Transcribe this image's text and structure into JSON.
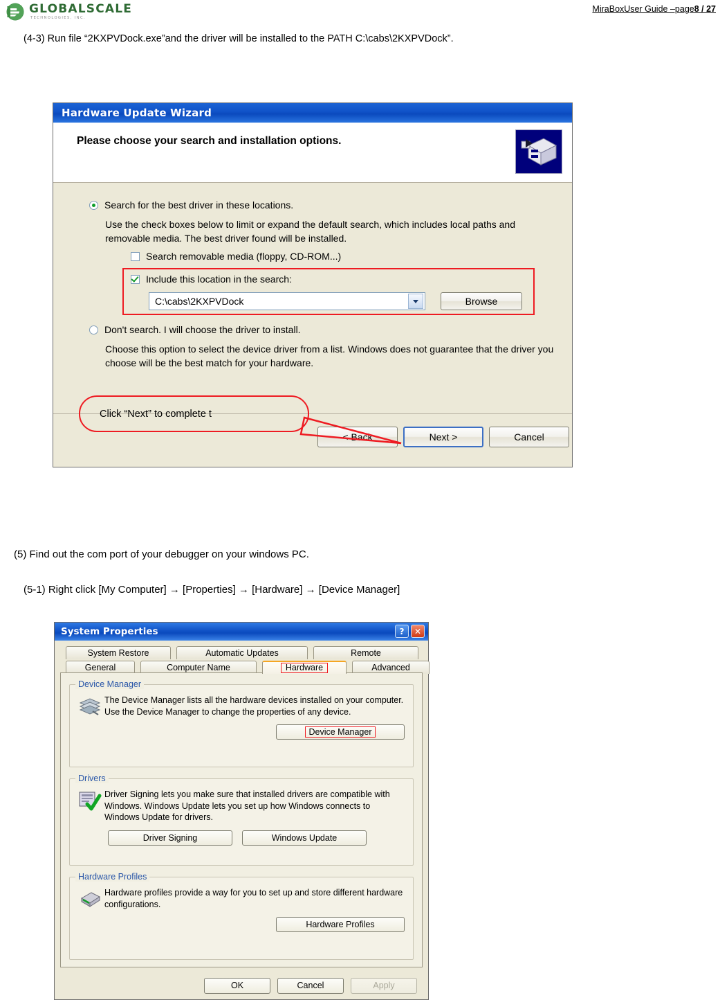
{
  "header": {
    "logo_name": "GLOBALSCALE",
    "logo_sub": "TECHNOLOGIES, INC.",
    "right_prefix": "MiraBoxUser Guide –page",
    "right_page": "8 / 27"
  },
  "doc": {
    "step_4_3": "(4-3) Run file “2KXPVDock.exe”and the driver will be installed to the PATH   C:\\cabs\\2KXPVDock”.",
    "step_5": "(5)  Find out the com port of your debugger on your windows PC.",
    "step_5_1": "(5-1) Right click [My Computer] → [Properties] → [Hardware] → [Device Manager]"
  },
  "wizard": {
    "title": "Hardware Update Wizard",
    "heading": "Please choose your search and installation options.",
    "option_search_label": "Search for the best driver in these locations.",
    "option_search_desc": "Use the check boxes below to limit or expand the default search, which includes local paths and removable media. The best driver found will be installed.",
    "checkbox_removable_label": "Search removable media (floppy, CD-ROM...)",
    "checkbox_include_label": "Include this location in the search:",
    "location_value": "C:\\cabs\\2KXPVDock",
    "browse_label": "Browse",
    "option_dontsearch_label": "Don't search. I will choose the driver to install.",
    "option_dontsearch_desc": "Choose this option to select the device driver from a list.  Windows does not guarantee that the driver you choose will be the best match for your hardware.",
    "back_label": "< Back",
    "next_label": "Next >",
    "cancel_label": "Cancel",
    "callout_text": "Click “Next” to complete t",
    "annotation_color": "#ee1b22"
  },
  "system_properties": {
    "title": "System Properties",
    "help_glyph": "?",
    "close_glyph": "✕",
    "tabs_row1": [
      "System Restore",
      "Automatic Updates",
      "Remote"
    ],
    "tabs_row2": [
      "General",
      "Computer Name",
      "Hardware",
      "Advanced"
    ],
    "active_tab": "Hardware",
    "device_manager": {
      "group_title": "Device Manager",
      "description": "The Device Manager lists all the hardware devices installed on your computer. Use the Device Manager to change the properties of any device.",
      "button_label": "Device Manager"
    },
    "drivers": {
      "group_title": "Drivers",
      "description": "Driver Signing lets you make sure that installed drivers are compatible with Windows. Windows Update lets you set up how Windows connects to Windows Update for drivers.",
      "button_signing_label": "Driver Signing",
      "button_update_label": "Windows Update"
    },
    "hardware_profiles": {
      "group_title": "Hardware Profiles",
      "description": "Hardware profiles provide a way for you to set up and store different hardware configurations.",
      "button_label": "Hardware Profiles"
    },
    "ok_label": "OK",
    "cancel_label": "Cancel",
    "apply_label": "Apply"
  }
}
